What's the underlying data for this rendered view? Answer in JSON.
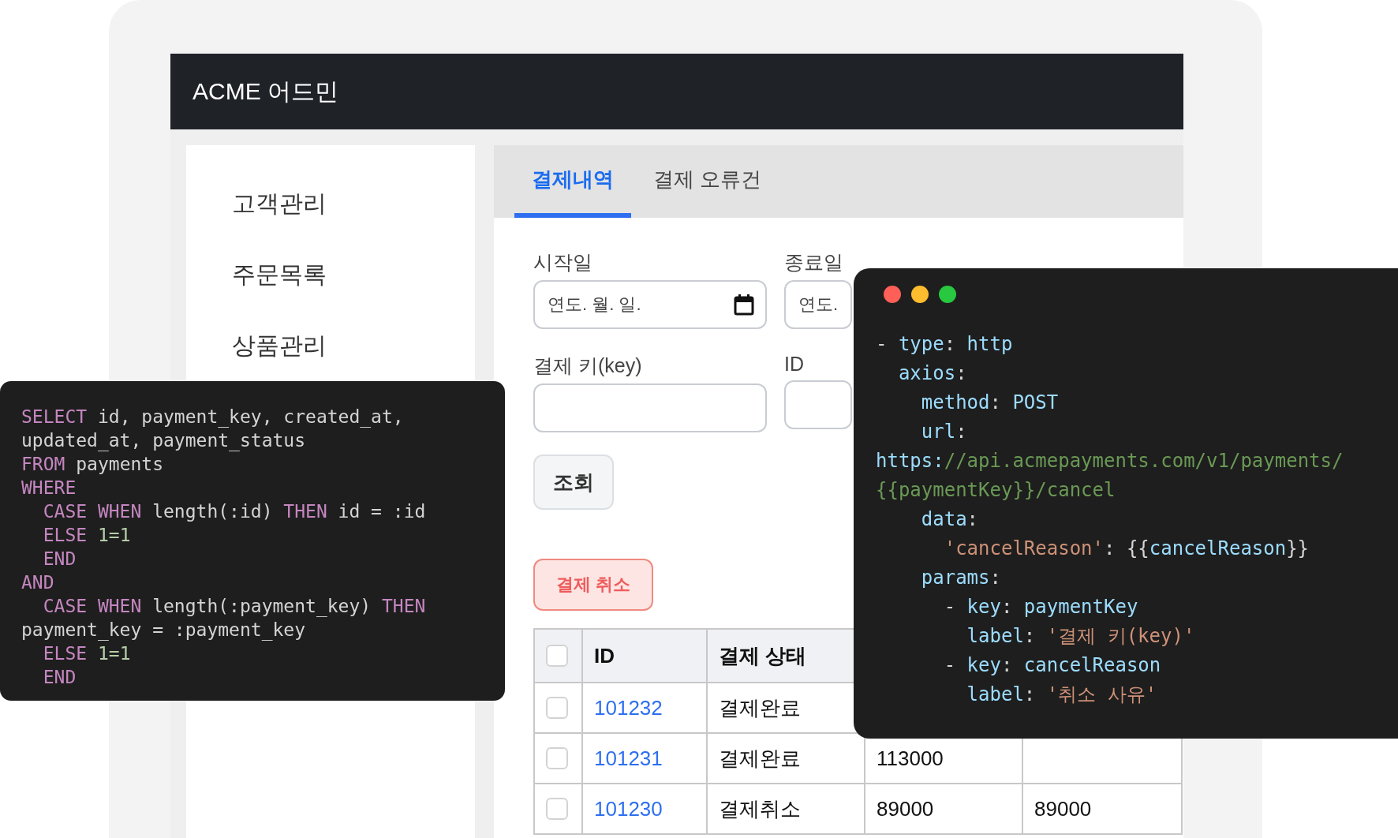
{
  "header": {
    "title": "ACME 어드민"
  },
  "sidebar": {
    "items": [
      {
        "label": "고객관리"
      },
      {
        "label": "주문목록"
      },
      {
        "label": "상품관리"
      }
    ]
  },
  "tabs": [
    {
      "label": "결제내역",
      "selected": true
    },
    {
      "label": "결제 오류건",
      "selected": false
    }
  ],
  "filters": {
    "start_date": {
      "label": "시작일",
      "placeholder": "연도. 월. 일."
    },
    "end_date": {
      "label": "종료일",
      "placeholder": "연도."
    },
    "payment_key": {
      "label": "결제 키(key)"
    },
    "id": {
      "label": "ID"
    }
  },
  "search_button": "조회",
  "cancel_button": "결제 취소",
  "table": {
    "select_all_checked": false,
    "columns": [
      "ID",
      "결제 상태"
    ],
    "rows": [
      {
        "checked": false,
        "id": "101232",
        "status": "결제완료"
      },
      {
        "checked": false,
        "id": "101231",
        "status": "결제완료",
        "column_4": "113000"
      },
      {
        "checked": false,
        "id": "101230",
        "status": "결제취소",
        "column_4": "89000",
        "column_5": "89000"
      }
    ]
  },
  "sql_panel": {
    "lines": [
      [
        {
          "t": "SELECT",
          "kind": "kw"
        },
        {
          "t": " id, payment_key, created_at,",
          "kind": "p"
        }
      ],
      [
        {
          "t": "updated_at, payment_status",
          "kind": "p"
        }
      ],
      [
        {
          "t": "FROM",
          "kind": "kw"
        },
        {
          "t": " payments",
          "kind": "p"
        }
      ],
      [
        {
          "t": "WHERE",
          "kind": "kw"
        }
      ],
      [
        {
          "t": "  CASE WHEN",
          "kind": "kw"
        },
        {
          "t": " length(:id) ",
          "kind": "p"
        },
        {
          "t": "THEN",
          "kind": "kw"
        },
        {
          "t": " id = :id",
          "kind": "p"
        }
      ],
      [
        {
          "t": "  ELSE",
          "kind": "kw"
        },
        {
          "t": " 1=1",
          "kind": "num"
        }
      ],
      [
        {
          "t": "  END",
          "kind": "kw"
        }
      ],
      [
        {
          "t": "AND",
          "kind": "kw"
        }
      ],
      [
        {
          "t": "  CASE WHEN",
          "kind": "kw"
        },
        {
          "t": " length(:payment_key) ",
          "kind": "p"
        },
        {
          "t": "THEN",
          "kind": "kw"
        }
      ],
      [
        {
          "t": "payment_key = :payment_key",
          "kind": "p"
        }
      ],
      [
        {
          "t": "  ELSE",
          "kind": "kw"
        },
        {
          "t": " 1=1",
          "kind": "num"
        }
      ],
      [
        {
          "t": "  END",
          "kind": "kw"
        }
      ]
    ]
  },
  "yaml_panel": {
    "lines": [
      [
        {
          "t": "- ",
          "kind": "p"
        },
        {
          "t": "type",
          "kind": "key"
        },
        {
          "t": ": ",
          "kind": "p"
        },
        {
          "t": "http",
          "kind": "val"
        }
      ],
      [
        {
          "t": "  axios",
          "kind": "key"
        },
        {
          "t": ":",
          "kind": "p"
        }
      ],
      [
        {
          "t": "    method",
          "kind": "key"
        },
        {
          "t": ": ",
          "kind": "p"
        },
        {
          "t": "POST",
          "kind": "val"
        }
      ],
      [
        {
          "t": "    url",
          "kind": "key"
        },
        {
          "t": ":",
          "kind": "p"
        }
      ],
      [
        {
          "t": "https:",
          "kind": "key"
        },
        {
          "t": "//api.acmepayments.com/v1/payments/",
          "kind": "url"
        }
      ],
      [
        {
          "t": "{{paymentKey}}/cancel",
          "kind": "url"
        }
      ],
      [
        {
          "t": "    data",
          "kind": "key"
        },
        {
          "t": ":",
          "kind": "p"
        }
      ],
      [
        {
          "t": "      'cancelReason'",
          "kind": "str"
        },
        {
          "t": ": {{",
          "kind": "p"
        },
        {
          "t": "cancelReason",
          "kind": "val"
        },
        {
          "t": "}}",
          "kind": "p"
        }
      ],
      [
        {
          "t": "    params",
          "kind": "key"
        },
        {
          "t": ":",
          "kind": "p"
        }
      ],
      [
        {
          "t": "      - ",
          "kind": "p"
        },
        {
          "t": "key",
          "kind": "key"
        },
        {
          "t": ": ",
          "kind": "p"
        },
        {
          "t": "paymentKey",
          "kind": "val"
        }
      ],
      [
        {
          "t": "        label",
          "kind": "key"
        },
        {
          "t": ": ",
          "kind": "p"
        },
        {
          "t": "'결제 키(key)'",
          "kind": "str"
        }
      ],
      [
        {
          "t": "      - ",
          "kind": "p"
        },
        {
          "t": "key",
          "kind": "key"
        },
        {
          "t": ": ",
          "kind": "p"
        },
        {
          "t": "cancelReason",
          "kind": "val"
        }
      ],
      [
        {
          "t": "        label",
          "kind": "key"
        },
        {
          "t": ": ",
          "kind": "p"
        },
        {
          "t": "'취소 사유'",
          "kind": "str"
        }
      ]
    ]
  }
}
